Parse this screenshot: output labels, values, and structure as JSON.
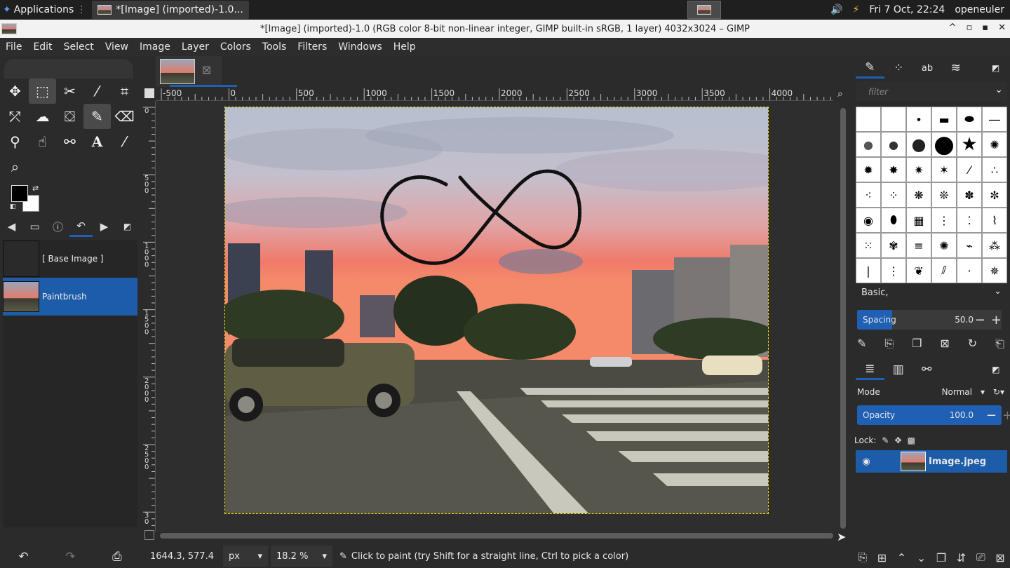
{
  "system_bar": {
    "applications_label": "Applications",
    "task_label": "*[Image] (imported)-1.0...",
    "datetime": "Fri  7 Oct, 22:24",
    "user": "openeuler"
  },
  "window": {
    "title": "*[Image] (imported)-1.0 (RGB color 8-bit non-linear integer, GIMP built-in sRGB, 1 layer) 4032x3024 – GIMP"
  },
  "menu": [
    "File",
    "Edit",
    "Select",
    "View",
    "Image",
    "Layer",
    "Colors",
    "Tools",
    "Filters",
    "Windows",
    "Help"
  ],
  "toolbox": {
    "tools": [
      {
        "name": "move-tool-icon",
        "glyph": "✥"
      },
      {
        "name": "rect-select-tool-icon",
        "glyph": "⬚"
      },
      {
        "name": "scissors-select-tool-icon",
        "glyph": "✂"
      },
      {
        "name": "fuzzy-select-tool-icon",
        "glyph": "⁄"
      },
      {
        "name": "crop-tool-icon",
        "glyph": "⌗"
      },
      {
        "name": "unified-transform-tool-icon",
        "glyph": "⤱"
      },
      {
        "name": "warp-transform-tool-icon",
        "glyph": "☁"
      },
      {
        "name": "bucket-fill-tool-icon",
        "glyph": "⛋"
      },
      {
        "name": "paintbrush-tool-icon",
        "glyph": "🖌"
      },
      {
        "name": "eraser-tool-icon",
        "glyph": "⌫"
      },
      {
        "name": "clone-tool-icon",
        "glyph": "⚲"
      },
      {
        "name": "smudge-tool-icon",
        "glyph": "☝"
      },
      {
        "name": "paths-tool-icon",
        "glyph": "⚯"
      },
      {
        "name": "text-tool-icon",
        "glyph": "A"
      },
      {
        "name": "color-picker-tool-icon",
        "glyph": "⁄"
      },
      {
        "name": "zoom-tool-icon",
        "glyph": "⌕"
      }
    ]
  },
  "history": {
    "items": [
      {
        "label": "[ Base Image ]",
        "selected": false
      },
      {
        "label": "Paintbrush",
        "selected": true
      }
    ]
  },
  "ruler": {
    "h_labels": [
      "-500",
      "0",
      "500",
      "1000",
      "1500",
      "2000",
      "2500",
      "3000",
      "3500",
      "4000"
    ],
    "v_labels": [
      "0",
      "5 0 0",
      "1 0 0 0",
      "1 5 0 0",
      "2 0 0 0",
      "2 5 0 0",
      "3 0"
    ]
  },
  "statusbar": {
    "coords": "1644.3, 577.4",
    "unit": "px",
    "zoom": "18.2 %",
    "message": "Click to paint (try Shift for a straight line, Ctrl to pick a color)"
  },
  "brushes": {
    "filter_placeholder": "filter",
    "preset": "Basic,",
    "spacing_label": "Spacing",
    "spacing_value": "50.0"
  },
  "layers": {
    "mode_label": "Mode",
    "mode_value": "Normal",
    "opacity_label": "Opacity",
    "opacity_value": "100.0",
    "lock_label": "Lock:",
    "layer_name": "Image.jpeg"
  }
}
